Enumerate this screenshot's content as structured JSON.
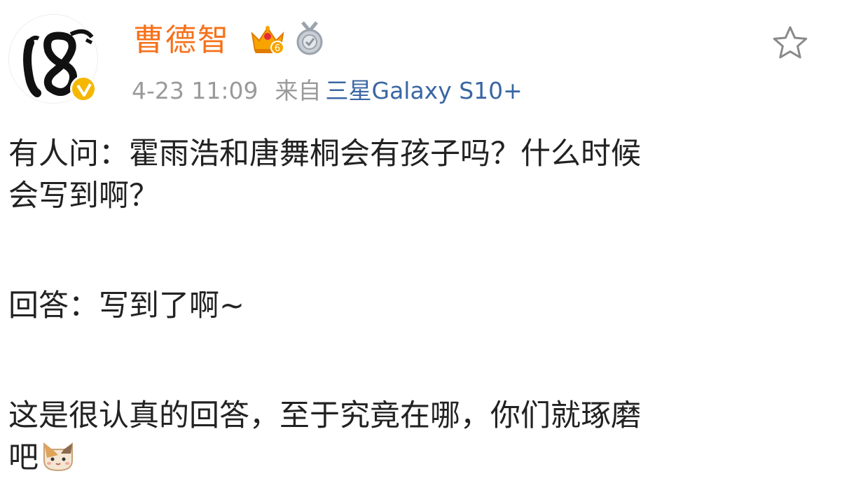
{
  "user": {
    "name": "曹德智",
    "avatar_icon": "calligraphy-18-avatar",
    "verified_icon": "verified-v-badge",
    "vip_level": "6",
    "medal_icon": "silver-medal-icon"
  },
  "meta": {
    "timestamp": "4-23 11:09",
    "source_prefix": "来自",
    "source": "三星Galaxy S10+"
  },
  "post": {
    "line1": "有人问：霍雨浩和唐舞桐会有孩子吗？什么时候",
    "line2": "会写到啊？",
    "line3": "回答：写到了啊~",
    "line4": "这是很认真的回答，至于究竟在哪，你们就琢磨",
    "line5": "吧",
    "emoji": "cat-face-emoji"
  },
  "colors": {
    "username": "#f7711a",
    "meta": "#9a9a9a",
    "source_link": "#3a66a3",
    "verified": "#f5b700"
  }
}
